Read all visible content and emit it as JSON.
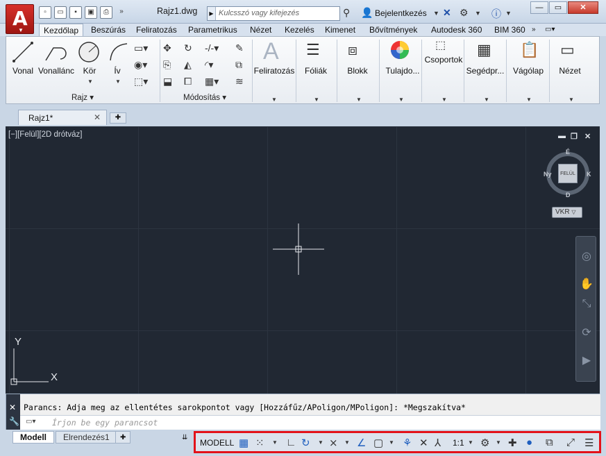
{
  "window": {
    "title": "Rajz1.dwg",
    "search_placeholder": "Kulcsszó vagy kifejezés",
    "login_label": "Bejelentkezés"
  },
  "ribbon_tabs": [
    "Kezdőlap",
    "Beszúrás",
    "Feliratozás",
    "Parametrikus",
    "Nézet",
    "Kezelés",
    "Kimenet",
    "Bővítmények",
    "Autodesk 360",
    "BIM 360"
  ],
  "ribbon": {
    "draw_tools": [
      "Vonal",
      "Vonallánc",
      "Kör",
      "Ív"
    ],
    "draw_group_label": "Rajz",
    "modify_group_label": "Módosítás",
    "big_buttons": [
      "Feliratozás",
      "Fóliák",
      "Blokk",
      "Tulajdo...",
      "Csoportok",
      "Segédpr...",
      "Vágólap",
      "Nézet"
    ]
  },
  "file_tabs": {
    "current": "Rajz1*"
  },
  "viewport": {
    "label": "[−][Felül][2D drótváz]",
    "viewcube_top": "FELÜL",
    "compass": {
      "n": "É",
      "s": "D",
      "w": "Ny",
      "e": "K"
    },
    "ucs_label": "VKR",
    "axis_x": "X",
    "axis_y": "Y"
  },
  "command": {
    "history": "Parancs: Adja meg az ellentétes sarokpontot vagy [Hozzáfűz/APoligon/MPoligon]: *Megszakítva*",
    "placeholder": "Írjon be egy parancsot"
  },
  "layout_tabs": [
    "Modell",
    "Elrendezés1"
  ],
  "statusbar": {
    "model_label": "MODELL",
    "scale_label": "1:1"
  }
}
